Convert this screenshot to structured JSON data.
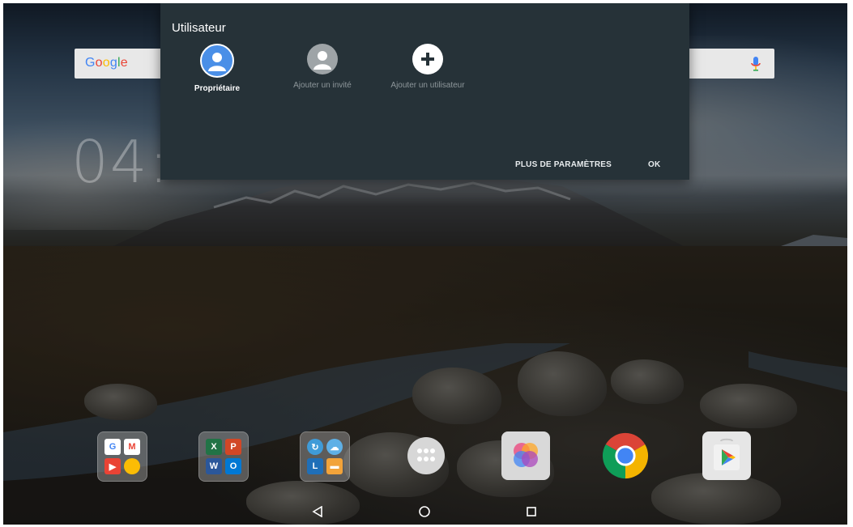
{
  "dialog": {
    "title": "Utilisateur",
    "users": [
      {
        "label": "Propriétaire",
        "icon": "owner-avatar-icon",
        "active": true
      },
      {
        "label": "Ajouter un invité",
        "icon": "guest-avatar-icon",
        "active": false
      },
      {
        "label": "Ajouter un utilisateur",
        "icon": "add-user-icon",
        "active": false
      }
    ],
    "more_settings_label": "PLUS DE PARAMÈTRES",
    "ok_label": "OK"
  },
  "search": {
    "logo_text": "Google",
    "mic_icon": "mic-icon"
  },
  "clock": {
    "visible_text": "04:"
  },
  "dock": {
    "items": [
      {
        "name": "google-apps-folder",
        "icon": "folder-icon"
      },
      {
        "name": "office-apps-folder",
        "icon": "folder-icon"
      },
      {
        "name": "lenovo-apps-folder",
        "icon": "folder-icon",
        "mini_label": "L"
      },
      {
        "name": "app-drawer",
        "icon": "app-drawer-icon"
      },
      {
        "name": "app-four-circles",
        "icon": "circles-app-icon"
      },
      {
        "name": "chrome",
        "icon": "chrome-icon"
      },
      {
        "name": "play-store",
        "icon": "play-store-icon"
      }
    ]
  },
  "navbar": {
    "back_icon": "back-icon",
    "home_icon": "home-icon",
    "recents_icon": "recents-icon"
  },
  "colors": {
    "dialog_bg": "#263238",
    "active_avatar": "#4a8fe7",
    "google_blue": "#4285f4",
    "google_red": "#ea4335",
    "google_yellow": "#fbbc05",
    "google_green": "#34a853"
  }
}
